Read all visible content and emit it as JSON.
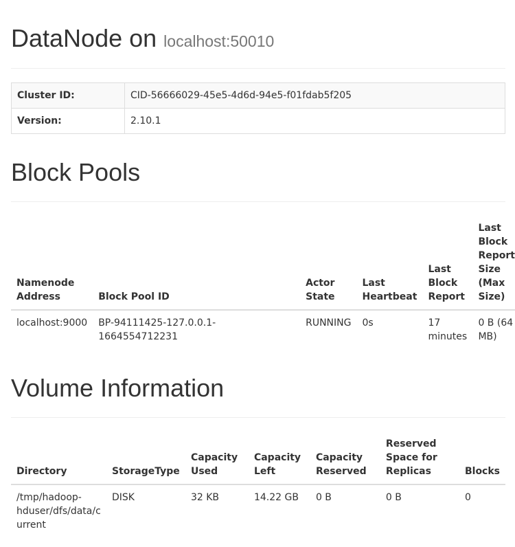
{
  "header": {
    "title": "DataNode on",
    "subtitle": "localhost:50010"
  },
  "overview": {
    "rows": [
      {
        "label": "Cluster ID:",
        "value": "CID-56666029-45e5-4d6d-94e5-f01fdab5f205"
      },
      {
        "label": "Version:",
        "value": "2.10.1"
      }
    ]
  },
  "block_pools": {
    "title": "Block Pools",
    "headers": [
      "Namenode Address",
      "Block Pool ID",
      "Actor State",
      "Last Heartbeat",
      "Last Block Report",
      "Last Block Report Size (Max Size)"
    ],
    "rows": [
      [
        "localhost:9000",
        "BP-94111425-127.0.0.1-1664554712231",
        "RUNNING",
        "0s",
        "17 minutes",
        "0 B (64 MB)"
      ]
    ]
  },
  "volumes": {
    "title": "Volume Information",
    "headers": [
      "Directory",
      "StorageType",
      "Capacity Used",
      "Capacity Left",
      "Capacity Reserved",
      "Reserved Space for Replicas",
      "Blocks"
    ],
    "rows": [
      [
        "/tmp/hadoop-hduser/dfs/data/current",
        "DISK",
        "32 KB",
        "14.22 GB",
        "0 B",
        "0 B",
        "0"
      ]
    ]
  }
}
